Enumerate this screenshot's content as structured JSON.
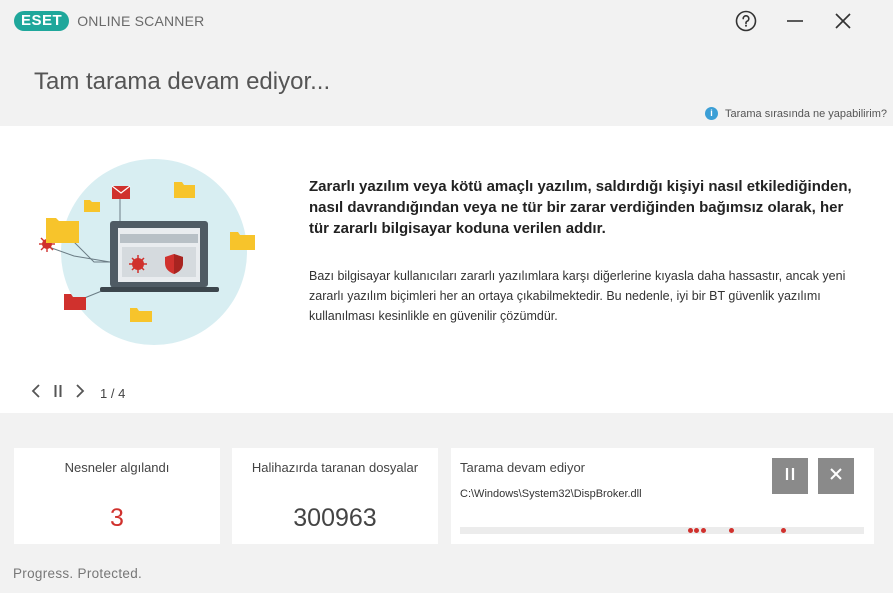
{
  "app": {
    "logo_text": "eset",
    "product_name": "ONLINE SCANNER",
    "accent_color": "#1fa79b"
  },
  "window_controls": {
    "help_icon": "question-circle-icon",
    "minimize_icon": "minimize-icon",
    "close_icon": "close-icon"
  },
  "header": {
    "title": "Tam tarama devam ediyor...",
    "help_link": "Tarama sırasında ne yapabilirim?"
  },
  "slide": {
    "heading": "Zararlı yazılım veya kötü amaçlı yazılım, saldırdığı kişiyi nasıl etkilediğinden, nasıl davrandığından veya ne tür bir zarar verdiğinden bağımsız olarak, her tür zararlı bilgisayar koduna verilen addır.",
    "body": "Bazı bilgisayar kullanıcıları zararlı yazılımlara karşı diğerlerine kıyasla daha hassastır, ancak yeni zararlı yazılım biçimleri her an ortaya çıkabilmektedir. Bu nedenle, iyi bir BT güvenlik yazılımı kullanılması kesinlikle en güvenilir çözümdür.",
    "counter": "1 / 4"
  },
  "stats": {
    "threats_label": "Nesneler algılandı",
    "threats_value": "3",
    "threats_color": "#d0312d",
    "files_label": "Halihazırda taranan dosyalar",
    "files_value": "300963",
    "scan_label": "Tarama devam ediyor",
    "scan_path": "C:\\Windows\\System32\\DispBroker.dll",
    "pause_icon": "pause-icon",
    "stop_icon": "close-icon"
  },
  "footer": {
    "tagline": "Progress. Protected."
  }
}
